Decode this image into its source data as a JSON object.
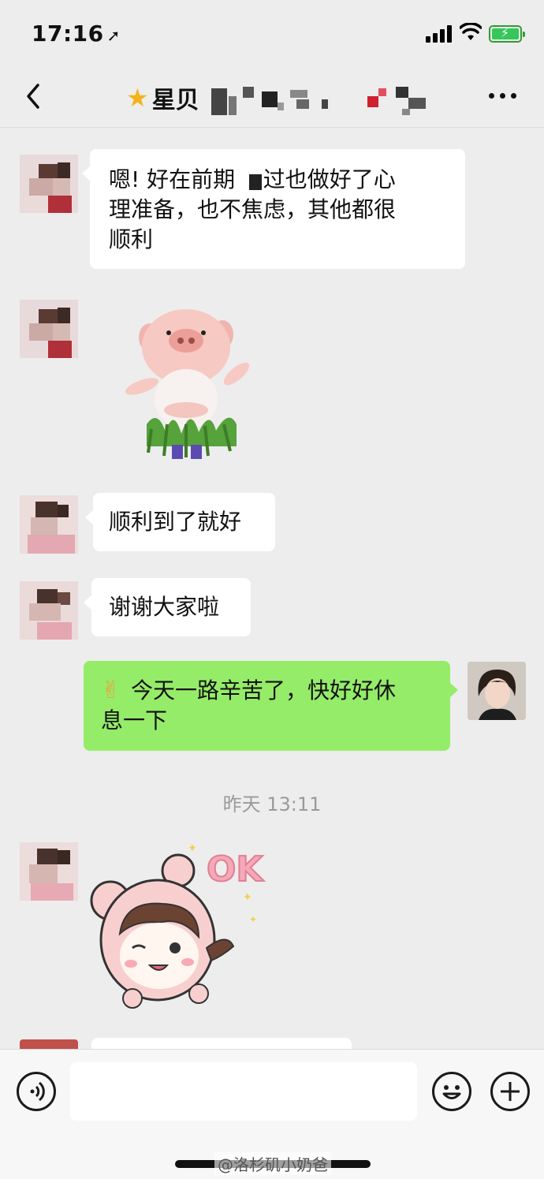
{
  "status_bar": {
    "time": "17:16",
    "location_glyph": "➚"
  },
  "nav": {
    "title_prefix": "星贝",
    "star_icon": "star-icon"
  },
  "messages": [
    {
      "side": "in",
      "type": "text",
      "text": "嗯! 好在前期    过也做好了心\n理准备，也不焦虑，其他都很\n顺利"
    },
    {
      "side": "in",
      "type": "sticker",
      "sticker": "pig-dancing-sticker"
    },
    {
      "side": "in",
      "type": "text",
      "text": "顺利到了就好"
    },
    {
      "side": "in",
      "type": "text",
      "text": "谢谢大家啦"
    },
    {
      "side": "out",
      "type": "text",
      "emoji": "✌",
      "text": "今天一路辛苦了，快好好休\n息一下"
    },
    {
      "side": "in",
      "type": "sticker",
      "sticker": "ok-girl-sticker",
      "sticker_text": "OK"
    }
  ],
  "timestamp": "昨天 13:11",
  "input_bar": {
    "placeholder": "",
    "voice_icon": "voice-icon",
    "emoji_icon": "emoji-icon",
    "plus_icon": "plus-icon"
  },
  "watermark": "@洛杉矶小奶爸",
  "colors": {
    "background": "#ededed",
    "incoming_bubble": "#ffffff",
    "outgoing_bubble": "#95ec69",
    "star": "#f3b31c",
    "battery": "#35c759"
  }
}
